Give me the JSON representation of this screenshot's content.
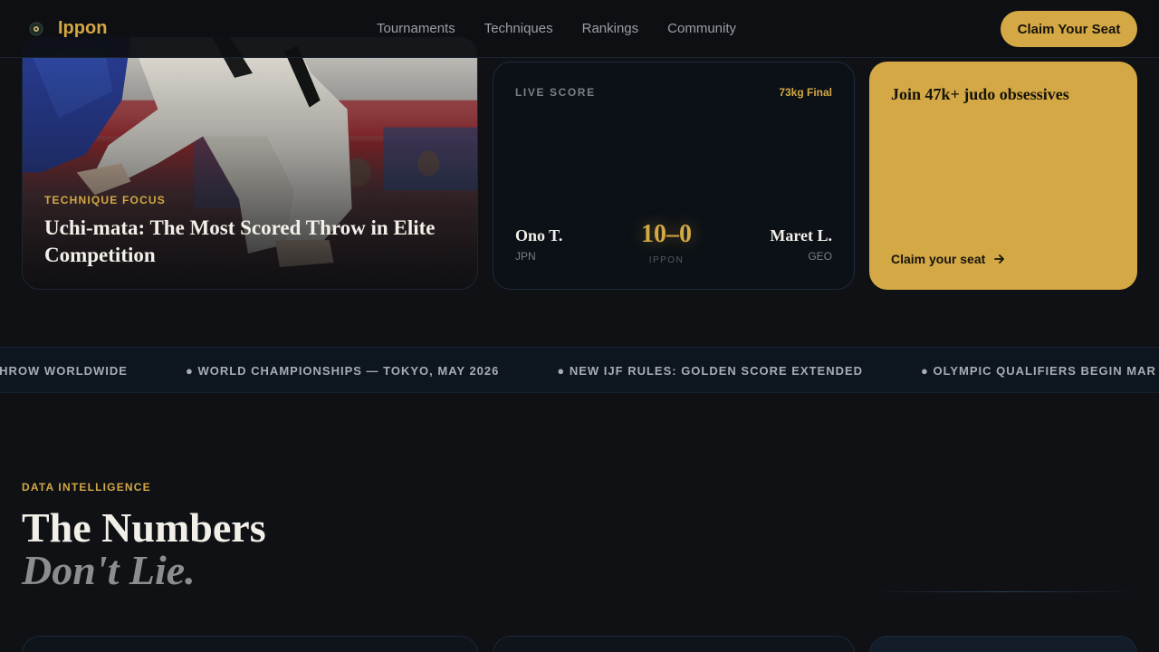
{
  "brand": {
    "name": "Ippon",
    "icon": "judo-emblem-icon"
  },
  "nav": {
    "links": [
      "Tournaments",
      "Techniques",
      "Rankings",
      "Community"
    ],
    "cta": "Claim Your Seat"
  },
  "technique_card": {
    "kicker": "TECHNIQUE FOCUS",
    "title": "Uchi-mata: The Most Scored Throw in Elite Competition"
  },
  "score_card": {
    "label": "LIVE SCORE",
    "event": "73kg Final",
    "fighter1": {
      "name": "Ono T.",
      "country": "JPN"
    },
    "fighter2": {
      "name": "Maret L.",
      "country": "GEO"
    },
    "score": "10–0",
    "result": "IPPON"
  },
  "join_card": {
    "title": "Join 47k+ judo obsessives",
    "link": "Claim your seat",
    "link_icon": "arrow-right-icon"
  },
  "ticker": {
    "items": [
      "ORING THROW WORLDWIDE",
      "● WORLD CHAMPIONSHIPS — TOKYO, MAY 2026",
      "● NEW IJF RULES: GOLDEN SCORE EXTENDED",
      "● OLYMPIC QUALIFIERS BEGIN MAR"
    ]
  },
  "stats": {
    "kicker": "DATA INTELLIGENCE",
    "title_line1": "The Numbers",
    "title_line2": "Don't Lie."
  },
  "colors": {
    "accent": "#d4a844",
    "background": "#0f1115",
    "panel": "#0c1117"
  }
}
